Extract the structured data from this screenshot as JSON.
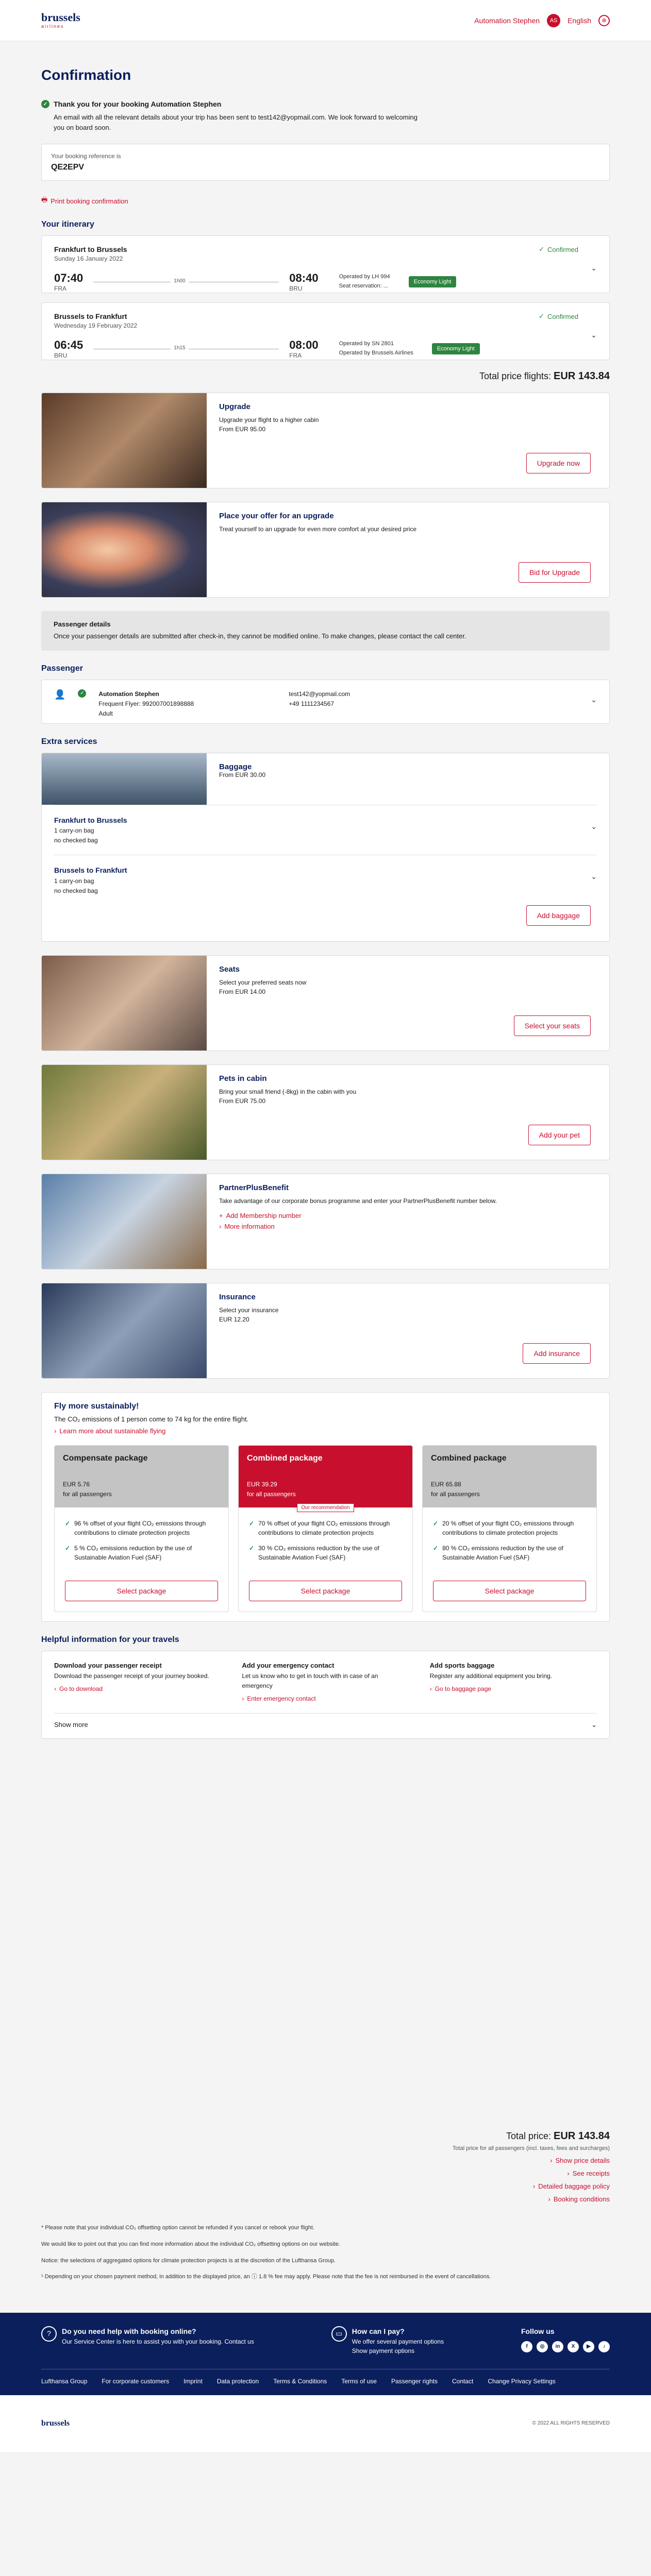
{
  "header": {
    "logo_text": "brussels",
    "logo_sub": "airlines",
    "user_name": "Automation Stephen",
    "user_initials": "AS",
    "language": "English",
    "colors": {
      "brand_red": "#c8102e",
      "navy": "#0b1f5c"
    }
  },
  "page": {
    "title": "Confirmation"
  },
  "thanks": {
    "title": "Thank you for your booking Automation Stephen",
    "body": "An email with all the relevant details about your trip has been sent to test142@yopmail.com. We look forward to welcoming you on board soon."
  },
  "reference": {
    "label": "Your booking reference is",
    "value": "QE2EPV"
  },
  "print_link": "Print booking confirmation",
  "itinerary": {
    "heading": "Your itinerary",
    "flights": [
      {
        "title": "Frankfurt to Brussels",
        "date": "Sunday 16 January 2022",
        "status": "Confirmed",
        "dep_time": "07:40",
        "dep_airport": "FRA",
        "duration": "1h00",
        "arr_time": "08:40",
        "arr_airport": "BRU",
        "operator": "Operated by LH 994",
        "operator2": "Seat reservation: ...",
        "fare": "Economy Light"
      },
      {
        "title": "Brussels to Frankfurt",
        "date": "Wednesday 19 February 2022",
        "status": "Confirmed",
        "dep_time": "06:45",
        "dep_airport": "BRU",
        "duration": "1h15",
        "arr_time": "08:00",
        "arr_airport": "FRA",
        "operator": "Operated by SN 2801",
        "operator2": "Operated by Brussels Airlines",
        "fare": "Economy Light"
      }
    ]
  },
  "total": {
    "label": "Total price flights:",
    "value": "EUR 143.84"
  },
  "upgrade": {
    "title": "Upgrade",
    "desc": "Upgrade your flight to a higher cabin",
    "price": "From EUR 95.00",
    "button": "Upgrade now"
  },
  "bid": {
    "title": "Place your offer for an upgrade",
    "desc": "Treat yourself to an upgrade for even more comfort at your desired price",
    "button": "Bid for Upgrade"
  },
  "pax_details": {
    "title": "Passenger details",
    "body": "Once your passenger details are submitted after check-in, they cannot be modified online. To make changes, please contact the call center."
  },
  "passenger": {
    "heading": "Passenger",
    "name": "Automation Stephen",
    "ff": "Frequent Flyer: 992007001898888",
    "type": "Adult",
    "email": "test142@yopmail.com",
    "phone": "+49 1111234567"
  },
  "extras": {
    "heading": "Extra services",
    "baggage": {
      "title": "Baggage",
      "price": "From EUR 30.00",
      "segments": [
        {
          "title": "Frankfurt to Brussels",
          "l1": "1 carry-on bag",
          "l2": "no checked bag"
        },
        {
          "title": "Brussels to Frankfurt",
          "l1": "1 carry-on bag",
          "l2": "no checked bag"
        }
      ],
      "button": "Add baggage"
    },
    "seats": {
      "title": "Seats",
      "desc": "Select your preferred seats now",
      "price": "From EUR 14.00",
      "button": "Select your seats"
    },
    "pets": {
      "title": "Pets in cabin",
      "desc": "Bring your small friend (-8kg) in the cabin with you",
      "price": "From EUR 75.00",
      "button": "Add your pet"
    },
    "partner": {
      "title": "PartnerPlusBenefit",
      "desc": "Take advantage of our corporate bonus programme and enter your PartnerPlusBenefit number below.",
      "link1": "Add Membership number",
      "link2": "More information"
    },
    "insurance": {
      "title": "Insurance",
      "desc": "Select your insurance",
      "price": "EUR 12.20",
      "button": "Add insurance"
    }
  },
  "sustainable": {
    "title": "Fly more sustainably!",
    "desc": "The CO₂ emissions of 1 person come to 74 kg for the entire flight.",
    "link": "Learn more about sustainable flying",
    "packages": [
      {
        "name": "Compensate package",
        "price": "EUR 5.76",
        "per": "for all passengers",
        "items": [
          "96 % offset of your flight CO₂ emissions through contributions to climate protection projects",
          "5 % CO₂ emissions reduction by the use of Sustainable Aviation Fuel (SAF)"
        ],
        "button": "Select package"
      },
      {
        "name": "Combined package",
        "price": "EUR 39.29",
        "per": "for all passengers",
        "tag": "Our recommendation",
        "items": [
          "70 % offset of your flight CO₂ emissions through contributions to climate protection projects",
          "30 % CO₂ emissions reduction by the use of Sustainable Aviation Fuel (SAF)"
        ],
        "button": "Select package"
      },
      {
        "name": "Combined package",
        "price": "EUR 65.88",
        "per": "for all passengers",
        "items": [
          "20 % offset of your flight CO₂ emissions through contributions to climate protection projects",
          "80 % CO₂ emissions reduction by the use of Sustainable Aviation Fuel (SAF)"
        ],
        "button": "Select package"
      }
    ]
  },
  "help": {
    "heading": "Helpful information for your travels",
    "items": [
      {
        "title": "Download your passenger receipt",
        "desc": "Download the passenger receipt of your journey booked.",
        "link": "Go to download"
      },
      {
        "title": "Add your emergency contact",
        "desc": "Let us know who to get in touch with in case of an emergency",
        "link": "Enter emergency contact"
      },
      {
        "title": "Add sports baggage",
        "desc": "Register any additional equipment you bring.",
        "link": "Go to baggage page"
      }
    ],
    "more": "Show more"
  },
  "footer_total": {
    "label": "Total price:",
    "value": "EUR 143.84",
    "sub": "Total price for all passengers (incl. taxes, fees and surcharges)",
    "links": [
      "Show price details",
      "See receipts",
      "Detailed baggage policy",
      "Booking conditions"
    ]
  },
  "notes": [
    "* Please note that your individual CO₂ offsetting option cannot be refunded if you cancel or rebook your flight.",
    "We would like to point out that you can find more information about the individual CO₂ offsetting options on our website.",
    "Notice: the selections of aggregated options for climate protection projects is at the discretion of the Lufthansa Group.",
    "¹ Depending on your chosen payment method, in addition to the displayed price, an ⓘ 1.8 % fee may apply. Please note that the fee is not reimbursed in the event of cancellations."
  ],
  "blue_footer": {
    "help_title": "Do you need help with booking online?",
    "help_desc": "Our Service Center is here to assist you with your booking. Contact us",
    "pay_title": "How can I pay?",
    "pay_desc": "We offer several payment options",
    "pay_link": "Show payment options",
    "follow": "Follow us",
    "links": [
      "Lufthansa Group",
      "For corporate customers",
      "Imprint",
      "Data protection",
      "Terms & Conditions",
      "Terms of use",
      "Passenger rights",
      "Contact",
      "Change Privacy Settings"
    ]
  },
  "bottom": {
    "logo": "brussels",
    "copyright": "© 2022 ALL RIGHTS RESERVED"
  }
}
